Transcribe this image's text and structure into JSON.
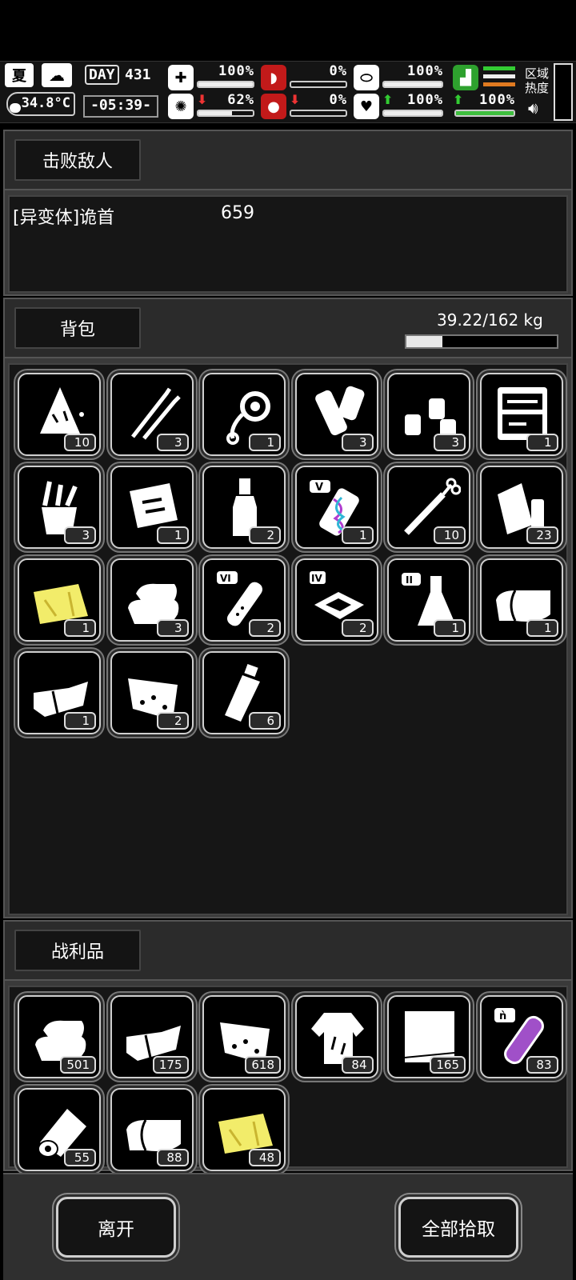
{
  "hud": {
    "season": "夏",
    "temperature": "34.8°C",
    "day_label": "DAY",
    "day": "431",
    "clock": "-05:39-",
    "stats": [
      {
        "value": "100%",
        "fill": 1.0
      },
      {
        "value": "0%",
        "fill": 0.0
      },
      {
        "value": "100%",
        "fill": 1.0
      },
      {
        "value": "62%",
        "fill": 0.62
      },
      {
        "value": "0%",
        "fill": 0.0
      },
      {
        "value": "100%",
        "fill": 1.0
      },
      {
        "value": "100%",
        "fill": 1.0
      }
    ],
    "zone_heat_label": "区域\n热度"
  },
  "defeated": {
    "tab": "击败敌人",
    "enemy_name": "[异变体]诡首",
    "enemy_value": "659"
  },
  "backpack": {
    "tab": "背包",
    "weight": "39.22/162 kg",
    "weight_fill": 0.242,
    "items": [
      {
        "icon": "rag-icon",
        "count": "10"
      },
      {
        "icon": "lockpick-icon",
        "count": "3"
      },
      {
        "icon": "rope-icon",
        "count": "1"
      },
      {
        "icon": "bandage-roll-icon",
        "count": "3"
      },
      {
        "icon": "fuel-bottles-icon",
        "count": "3"
      },
      {
        "icon": "toolbox-icon",
        "count": "1"
      },
      {
        "icon": "tool-bucket-icon",
        "count": "3"
      },
      {
        "icon": "repair-kit-icon",
        "count": "1"
      },
      {
        "icon": "liquor-bottle-icon",
        "count": "2"
      },
      {
        "icon": "gene-serum-icon",
        "count": "1"
      },
      {
        "icon": "syringe-icon",
        "count": "10"
      },
      {
        "icon": "fuel-can-icon",
        "count": "23"
      },
      {
        "icon": "yellow-cloth-icon",
        "count": "1"
      },
      {
        "icon": "folded-towels-icon",
        "count": "3"
      },
      {
        "icon": "test-tube-icon",
        "count": "2"
      },
      {
        "icon": "chip-icon",
        "count": "2"
      },
      {
        "icon": "flask-icon",
        "count": "1"
      },
      {
        "icon": "cloth-bolt-icon",
        "count": "1"
      },
      {
        "icon": "folded-fabric-icon",
        "count": "1"
      },
      {
        "icon": "burrito-icon",
        "count": "2"
      },
      {
        "icon": "water-bottle-icon",
        "count": "6"
      }
    ]
  },
  "loot": {
    "tab": "战利品",
    "items": [
      {
        "icon": "folded-towels-icon",
        "count": "501"
      },
      {
        "icon": "folded-fabric-icon",
        "count": "175"
      },
      {
        "icon": "burrito-icon",
        "count": "618"
      },
      {
        "icon": "torn-shirt-icon",
        "count": "84"
      },
      {
        "icon": "paper-sheets-icon",
        "count": "165"
      },
      {
        "icon": "purple-tube-icon",
        "count": "83"
      },
      {
        "icon": "paper-roll-icon",
        "count": "55"
      },
      {
        "icon": "cloth-bolt-icon",
        "count": "88"
      },
      {
        "icon": "yellow-cloth-icon",
        "count": "48"
      }
    ]
  },
  "footer": {
    "leave": "离开",
    "take_all": "全部拾取"
  },
  "colors": {
    "panel": "#3a3a3a",
    "panel_body": "#161616",
    "green": "#3fbf3f",
    "red": "#c21a1a"
  }
}
